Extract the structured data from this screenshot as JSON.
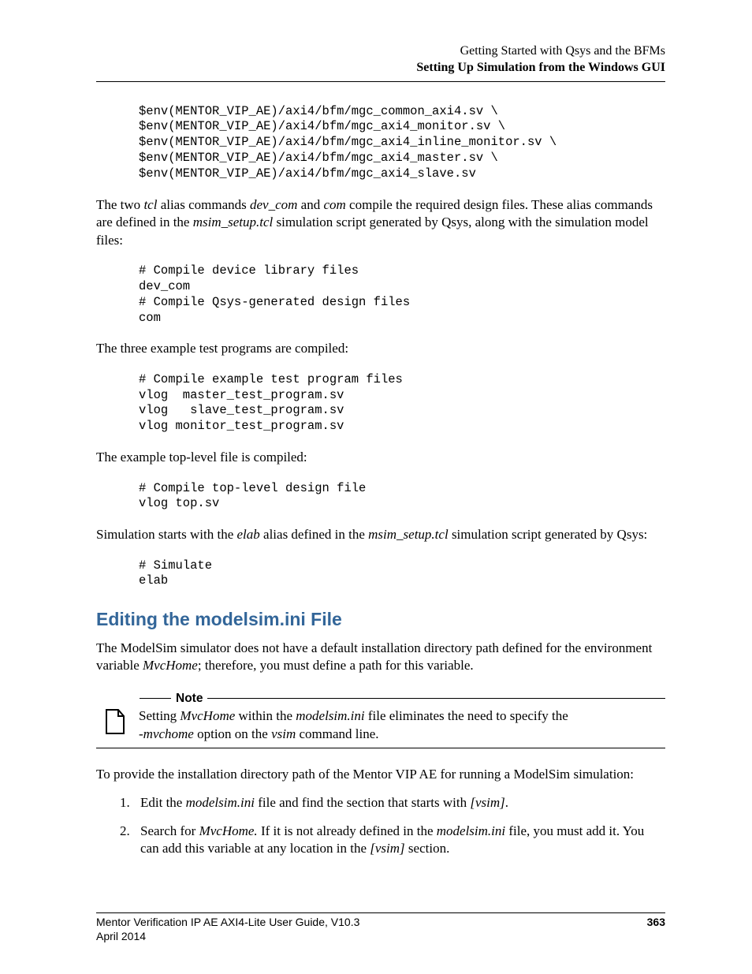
{
  "header": {
    "line1": "Getting Started with Qsys and the BFMs",
    "line2": "Setting Up Simulation from the Windows GUI"
  },
  "code1": "$env(MENTOR_VIP_AE)/axi4/bfm/mgc_common_axi4.sv \\\n$env(MENTOR_VIP_AE)/axi4/bfm/mgc_axi4_monitor.sv \\\n$env(MENTOR_VIP_AE)/axi4/bfm/mgc_axi4_inline_monitor.sv \\\n$env(MENTOR_VIP_AE)/axi4/bfm/mgc_axi4_master.sv \\\n$env(MENTOR_VIP_AE)/axi4/bfm/mgc_axi4_slave.sv",
  "para1": {
    "t1": "The two ",
    "i1": "tcl",
    "t2": " alias commands ",
    "i2": "dev_com",
    "t3": " and ",
    "i3": "com",
    "t4": " compile the required design files. These alias commands are defined in the ",
    "i4": "msim_setup.tcl",
    "t5": " simulation script generated by Qsys, along with the simulation model files:"
  },
  "code2": "# Compile device library files\ndev_com\n# Compile Qsys-generated design files\ncom",
  "para2": "The three example test programs are compiled:",
  "code3": "# Compile example test program files\nvlog  master_test_program.sv\nvlog   slave_test_program.sv\nvlog monitor_test_program.sv",
  "para3": "The example top-level file is compiled:",
  "code4": "# Compile top-level design file\nvlog top.sv",
  "para4": {
    "t1": "Simulation starts with the ",
    "i1": "elab",
    "t2": " alias defined in the ",
    "i2": "msim_setup.tcl",
    "t3": " simulation script generated by Qsys:"
  },
  "code5": "# Simulate\nelab",
  "h2": "Editing the modelsim.ini File",
  "para5": {
    "t1": "The ModelSim simulator does not have a default installation directory path defined for the environment variable ",
    "i1": "MvcHome",
    "t2": "; therefore, you must define a path for this variable."
  },
  "note": {
    "label": "Note",
    "t1": "Setting ",
    "i1": "MvcHome",
    "t2": " within the ",
    "i2": "modelsim.ini",
    "t3": " file eliminates the need to specify the ",
    "i3": "-mvchome",
    "t4": " option on the ",
    "i4": "vsim",
    "t5": " command line."
  },
  "para6": "To provide the installation directory path of the Mentor VIP AE for running a ModelSim simulation:",
  "list": {
    "n1": "1.",
    "li1": {
      "t1": "Edit the ",
      "i1": "modelsim.ini",
      "t2": " file and find the section that starts with ",
      "i2": "[vsim]",
      "t3": "."
    },
    "n2": "2.",
    "li2": {
      "t1": "Search for ",
      "i1": "MvcHome.",
      "t2": " If it is not already defined in the ",
      "i2": "modelsim.ini",
      "t3": " file, you must add it. You can add this variable at any location in the ",
      "i3": "[vsim]",
      "t4": " section."
    }
  },
  "footer": {
    "left": "Mentor Verification IP AE AXI4-Lite User Guide, V10.3",
    "page": "363",
    "date": "April 2014"
  }
}
